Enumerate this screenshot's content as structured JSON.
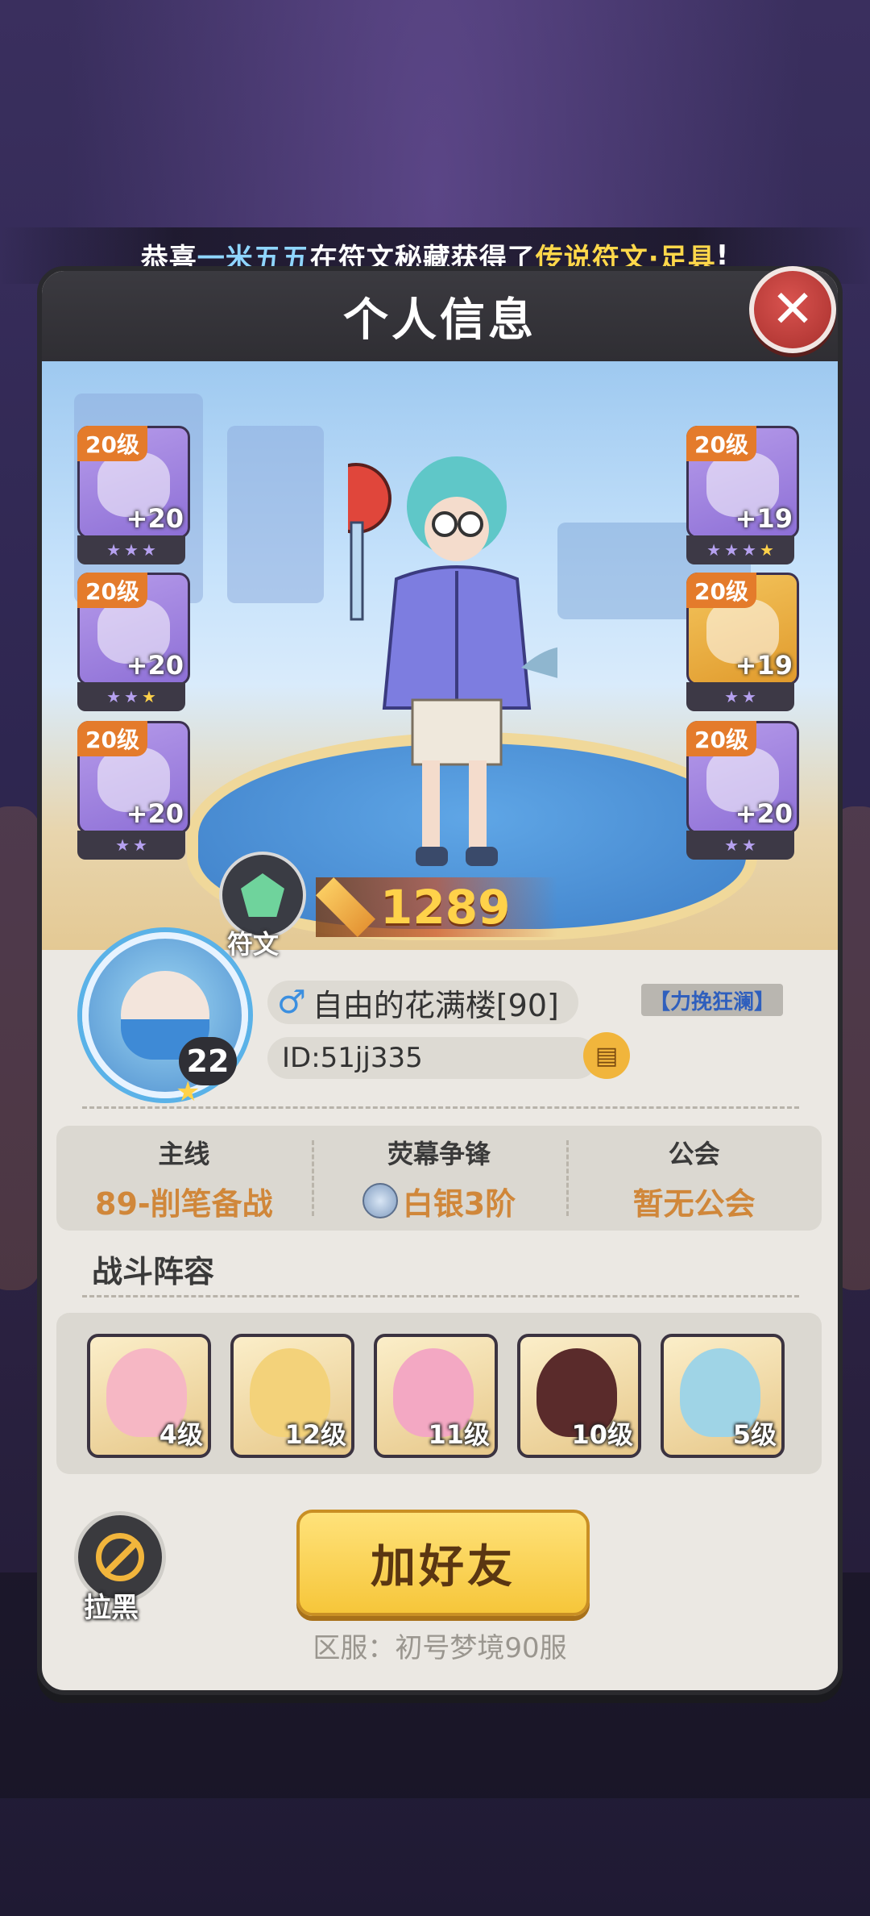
{
  "banner": {
    "prefix": "恭喜",
    "player": "一米五五",
    "middle": "在符文秘藏获得了",
    "item": "传说符文·足具",
    "suffix": "!"
  },
  "dialog": {
    "title": "个人信息",
    "close_icon": "close-icon"
  },
  "equipment": {
    "left": [
      {
        "level": "20级",
        "plus": "+20",
        "stars": 3,
        "gold_stars": 0,
        "icon": "helmet-icon"
      },
      {
        "level": "20级",
        "plus": "+20",
        "stars": 3,
        "gold_stars": 1,
        "icon": "bracer-icon"
      },
      {
        "level": "20级",
        "plus": "+20",
        "stars": 2,
        "gold_stars": 0,
        "icon": "shoe-icon"
      }
    ],
    "right": [
      {
        "level": "20级",
        "plus": "+19",
        "stars": 4,
        "gold_stars": 1,
        "icon": "armor-icon"
      },
      {
        "level": "20级",
        "plus": "+19",
        "stars": 2,
        "gold_stars": 0,
        "icon": "pants-icon"
      },
      {
        "level": "20级",
        "plus": "+20",
        "stars": 2,
        "gold_stars": 0,
        "icon": "orb-icon"
      }
    ]
  },
  "rune": {
    "label": "符文"
  },
  "power": {
    "value": "1289"
  },
  "profile": {
    "level": "22",
    "gender": "♂",
    "name": "自由的花满楼[90]",
    "title_tag": "【力挽狂澜】",
    "id": "ID:51jj335"
  },
  "stats": [
    {
      "label": "主线",
      "value": "89-削笔备战"
    },
    {
      "label": "荧幕争锋",
      "value": "白银3阶",
      "icon": "silver-rank-icon"
    },
    {
      "label": "公会",
      "value": "暂无公会"
    }
  ],
  "team": {
    "title": "战斗阵容",
    "heroes": [
      {
        "level": "4级",
        "color": "#f6b7c4"
      },
      {
        "level": "12级",
        "color": "#f3d27a"
      },
      {
        "level": "11级",
        "color": "#f3a8c3"
      },
      {
        "level": "10级",
        "color": "#5a2b2b"
      },
      {
        "level": "5级",
        "color": "#9fd4e6"
      }
    ]
  },
  "actions": {
    "block_label": "拉黑",
    "add_friend": "加好友"
  },
  "server": "区服：初号梦境90服"
}
